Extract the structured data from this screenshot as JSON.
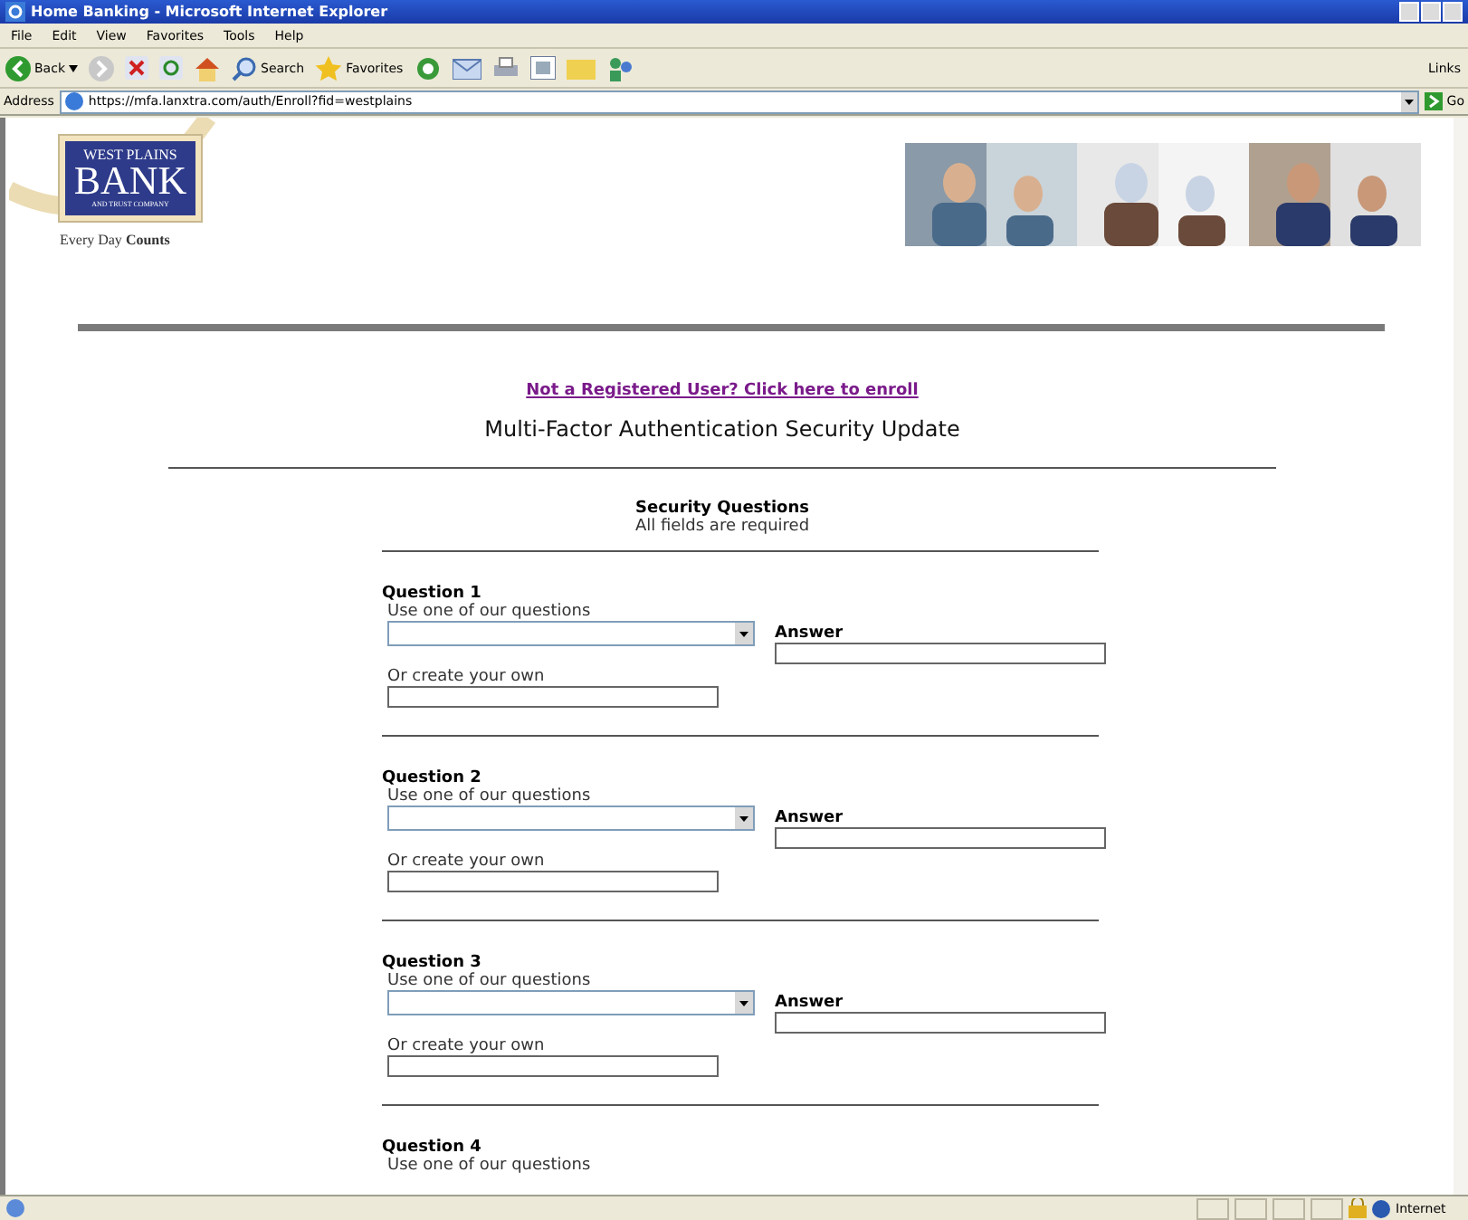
{
  "window": {
    "title": "Home Banking - Microsoft Internet Explorer"
  },
  "menu": [
    "File",
    "Edit",
    "View",
    "Favorites",
    "Tools",
    "Help"
  ],
  "toolbar": {
    "back": "Back",
    "search": "Search",
    "favorites": "Favorites",
    "links": "Links"
  },
  "address_bar": {
    "label": "Address",
    "url": "https://mfa.lanxtra.com/auth/Enroll?fid=westplains",
    "go": "Go"
  },
  "logo": {
    "line_1": "WEST PLAINS",
    "line_2": "BANK",
    "line_3": "AND TRUST COMPANY",
    "tagline": "Every Day **Counts**"
  },
  "enroll_link": "Not a Registered User? Click here to enroll",
  "heading": "Multi-Factor Authentication Security Update",
  "section": {
    "title": "Security Questions",
    "subtitle": "All fields are required"
  },
  "questions": [
    {
      "title": "Question 1",
      "choose_label": "Use one of our questions",
      "answer_label": "Answer",
      "own_label": "Or create your own"
    },
    {
      "title": "Question 2",
      "choose_label": "Use one of our questions",
      "answer_label": "Answer",
      "own_label": "Or create your own"
    },
    {
      "title": "Question 3",
      "choose_label": "Use one of our questions",
      "answer_label": "Answer",
      "own_label": "Or create your own"
    },
    {
      "title": "Question 4",
      "choose_label": "Use one of our questions"
    }
  ],
  "status_bar": {
    "zone": "Internet"
  }
}
